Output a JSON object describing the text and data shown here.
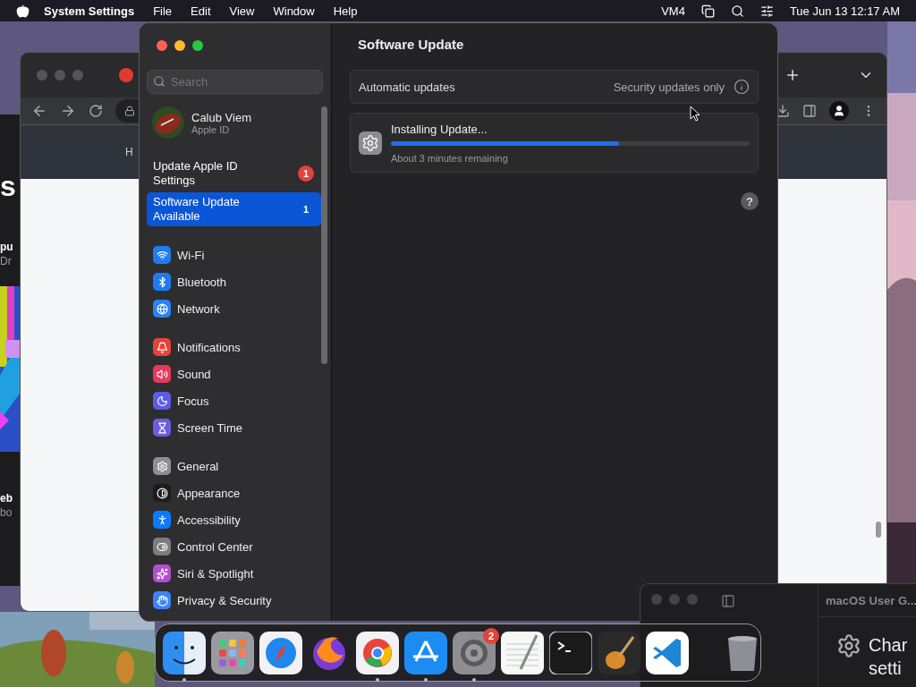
{
  "menu_bar": {
    "app_name": "System Settings",
    "menus": [
      "File",
      "Edit",
      "View",
      "Window",
      "Help"
    ],
    "status_text": "VM4",
    "clock": "Tue Jun 13  12:17 AM"
  },
  "left_window": {
    "heading": "s",
    "texts": [
      "pu",
      "Dr",
      "eb",
      "bo"
    ]
  },
  "browser_window": {
    "header_text": "H"
  },
  "settings": {
    "search": {
      "placeholder": "Search"
    },
    "account": {
      "name": "Calub Viem",
      "subtitle": "Apple ID"
    },
    "alerts": [
      {
        "label": "Update Apple ID Settings",
        "badge": "1",
        "selected": false
      },
      {
        "label": "Software Update Available",
        "badge": "1",
        "selected": true
      }
    ],
    "groups": [
      {
        "items": [
          {
            "label": "Wi-Fi",
            "color": "#1e7cf0",
            "selected": false
          },
          {
            "label": "Bluetooth",
            "color": "#1e7cf0",
            "selected": false
          },
          {
            "label": "Network",
            "color": "#2a82f5",
            "selected": false
          }
        ]
      },
      {
        "items": [
          {
            "label": "Notifications",
            "color": "#e5443a",
            "selected": false
          },
          {
            "label": "Sound",
            "color": "#e8365d",
            "selected": false
          },
          {
            "label": "Focus",
            "color": "#5e5ce6",
            "selected": false
          },
          {
            "label": "Screen Time",
            "color": "#6b5ce0",
            "selected": false
          }
        ]
      },
      {
        "items": [
          {
            "label": "General",
            "color": "#8e8e93",
            "selected": false
          },
          {
            "label": "Appearance",
            "color": "#1c1c1e",
            "selected": false
          },
          {
            "label": "Accessibility",
            "color": "#0a7aff",
            "selected": false
          },
          {
            "label": "Control Center",
            "color": "#7c7c80",
            "selected": false
          },
          {
            "label": "Siri & Spotlight",
            "color": "#b24fd0",
            "selected": false
          },
          {
            "label": "Privacy & Security",
            "color": "#3e82f7",
            "selected": false
          }
        ]
      }
    ],
    "page": {
      "title": "Software Update",
      "auto_updates": {
        "label": "Automatic updates",
        "value": "Security updates only"
      },
      "update": {
        "title": "Installing Update...",
        "level": 0.635,
        "status": "About 3 minutes remaining"
      },
      "help": "?"
    }
  },
  "guide_window": {
    "title": "macOS User G...",
    "texts": [
      "Char",
      "setti"
    ]
  },
  "dock": {
    "apps": [
      {
        "running": true
      },
      {
        "running": false
      },
      {
        "running": false
      },
      {
        "running": false
      },
      {
        "running": true
      },
      {
        "running": true
      },
      {
        "running": true,
        "badge": "2"
      },
      {
        "running": false
      },
      {
        "running": false
      },
      {
        "running": false
      },
      {
        "running": false
      },
      {
        "running": false
      }
    ]
  }
}
